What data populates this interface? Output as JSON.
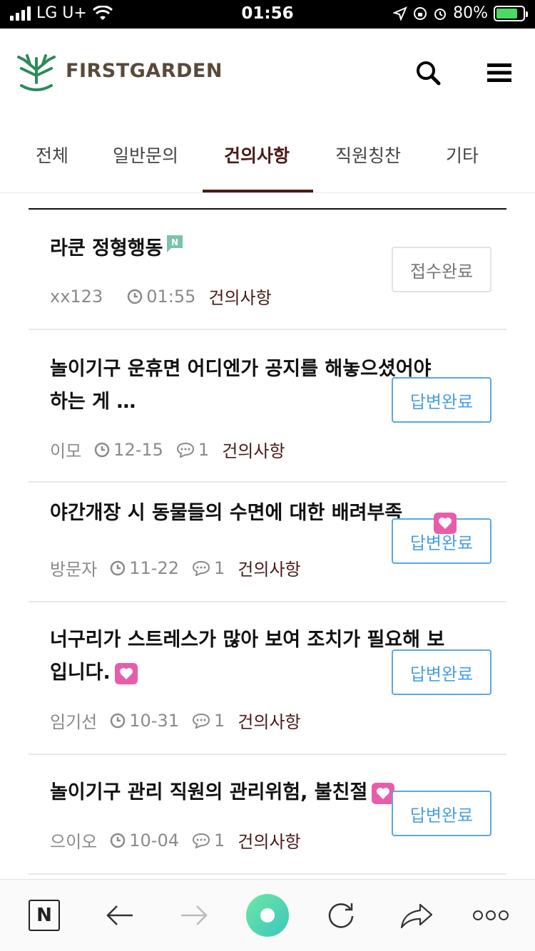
{
  "status_bar": {
    "carrier": "LG U+",
    "time": "01:56",
    "battery": "80%",
    "battery_level": 0.8
  },
  "header": {
    "logo_text": "FIRSTGARDEN",
    "brand_color": "#2e8a5a",
    "search_icon": "search-icon",
    "menu_icon": "hamburger-menu-icon"
  },
  "tabs": [
    {
      "label": "전체",
      "active": false
    },
    {
      "label": "일반문의",
      "active": false
    },
    {
      "label": "건의사항",
      "active": true
    },
    {
      "label": "직원칭찬",
      "active": false
    },
    {
      "label": "기타",
      "active": false
    }
  ],
  "colors": {
    "accent": "#4a1b17",
    "answered_badge": "#4a9fe6",
    "heart": "#e85da9"
  },
  "posts": [
    {
      "title": "라쿤 정형행동",
      "author": "xx123",
      "time": "01:55",
      "comments": "",
      "category": "건의사항",
      "status": "접수완료",
      "new": true
    },
    {
      "title": "놀이기구 운휴면 어디엔가 공지를 해놓으셨어야",
      "title2": "하는 게 …",
      "author": "이모",
      "time": "12-15",
      "comments": "1",
      "category": "건의사항",
      "status": "답변완료"
    },
    {
      "title": "야간개장 시 동물들의 수면에 대한 배려부족",
      "author": "방문자",
      "time": "11-22",
      "comments": "1",
      "category": "건의사항",
      "status": "답변완료",
      "heart": true
    },
    {
      "title": "너구리가 스트레스가 많아 보여 조치가 필요해 보",
      "title2": "입니다.",
      "author": "임기선",
      "time": "10-31",
      "comments": "1",
      "category": "건의사항",
      "status": "답변완료",
      "heart": true
    },
    {
      "title": "놀이기구 관리 직원의 관리위험, 불친절",
      "author": "으이오",
      "time": "10-04",
      "comments": "1",
      "category": "건의사항",
      "status": "답변완료",
      "heart": true
    }
  ],
  "toolbar": {
    "n_label": "N"
  }
}
